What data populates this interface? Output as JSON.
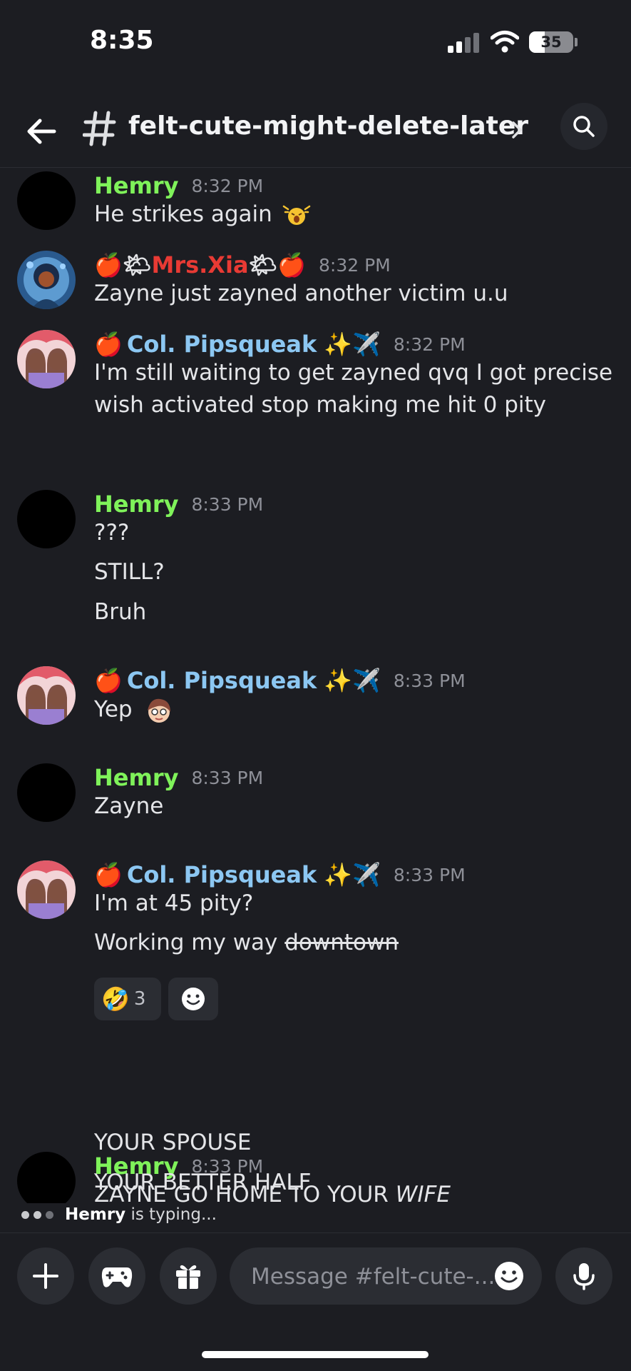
{
  "status_bar": {
    "time": "8:35",
    "battery": "35",
    "battery_level": 0.35
  },
  "header": {
    "channel_name": "felt-cute-might-delete-later",
    "icons": [
      "back-arrow-icon",
      "hash-icon",
      "chevron-right-icon",
      "search-icon"
    ]
  },
  "messages": [
    {
      "author": "Hemry",
      "time": "8:32 PM",
      "lines": [
        "He strikes again"
      ]
    },
    {
      "author_prefix": "🍎🌤",
      "author": "Mrs.Xia",
      "author_suffix": "🌤🍎",
      "time": "8:32 PM",
      "lines": [
        "Zayne just zayned another victim u.u"
      ]
    },
    {
      "author_prefix": "🍎",
      "author": "Col. Pipsqueak",
      "author_suffix": "✨✈️",
      "time": "8:32 PM",
      "lines": [
        "I'm still waiting to get zayned qvq I got precise",
        "wish activated stop making me hit 0 pity"
      ]
    },
    {
      "author": "Hemry",
      "time": "8:33 PM",
      "lines": [
        "???",
        "STILL?",
        "Bruh"
      ]
    },
    {
      "author_prefix": "🍎",
      "author": "Col. Pipsqueak",
      "author_suffix": "✨✈️",
      "time": "8:33 PM",
      "lines": [
        "Yep"
      ]
    },
    {
      "author": "Hemry",
      "time": "8:33 PM",
      "lines": [
        "Zayne"
      ]
    },
    {
      "author_prefix": "🍎",
      "author": "Col. Pipsqueak",
      "author_suffix": "✨✈️",
      "time": "8:33 PM",
      "lines": [
        "I'm at 45 pity?"
      ],
      "line2_prefix": "Working my way ",
      "line2_strike": "downtown",
      "reaction_emoji": "🤣",
      "reaction_count": "3"
    },
    {
      "author": "Hemry",
      "time": "8:33 PM",
      "line1_prefix": "ZAYNE GO HOME TO YOUR ",
      "line1_italic": "WIFE",
      "lines": [
        "YOUR SPOUSE",
        "YOUR BETTER HALF"
      ]
    }
  ],
  "typing": {
    "user": "Hemry",
    "text": " is typing..."
  },
  "composer": {
    "placeholder": "Message #felt-cute-...",
    "icons": [
      "plus-icon",
      "gamepad-icon",
      "gift-icon",
      "emoji-icon",
      "microphone-icon"
    ]
  },
  "colors": {
    "background": "#1c1d22",
    "hemry": "#7ff25a",
    "pipsqueak": "#8cc7f2",
    "xia": "#e83a34"
  }
}
